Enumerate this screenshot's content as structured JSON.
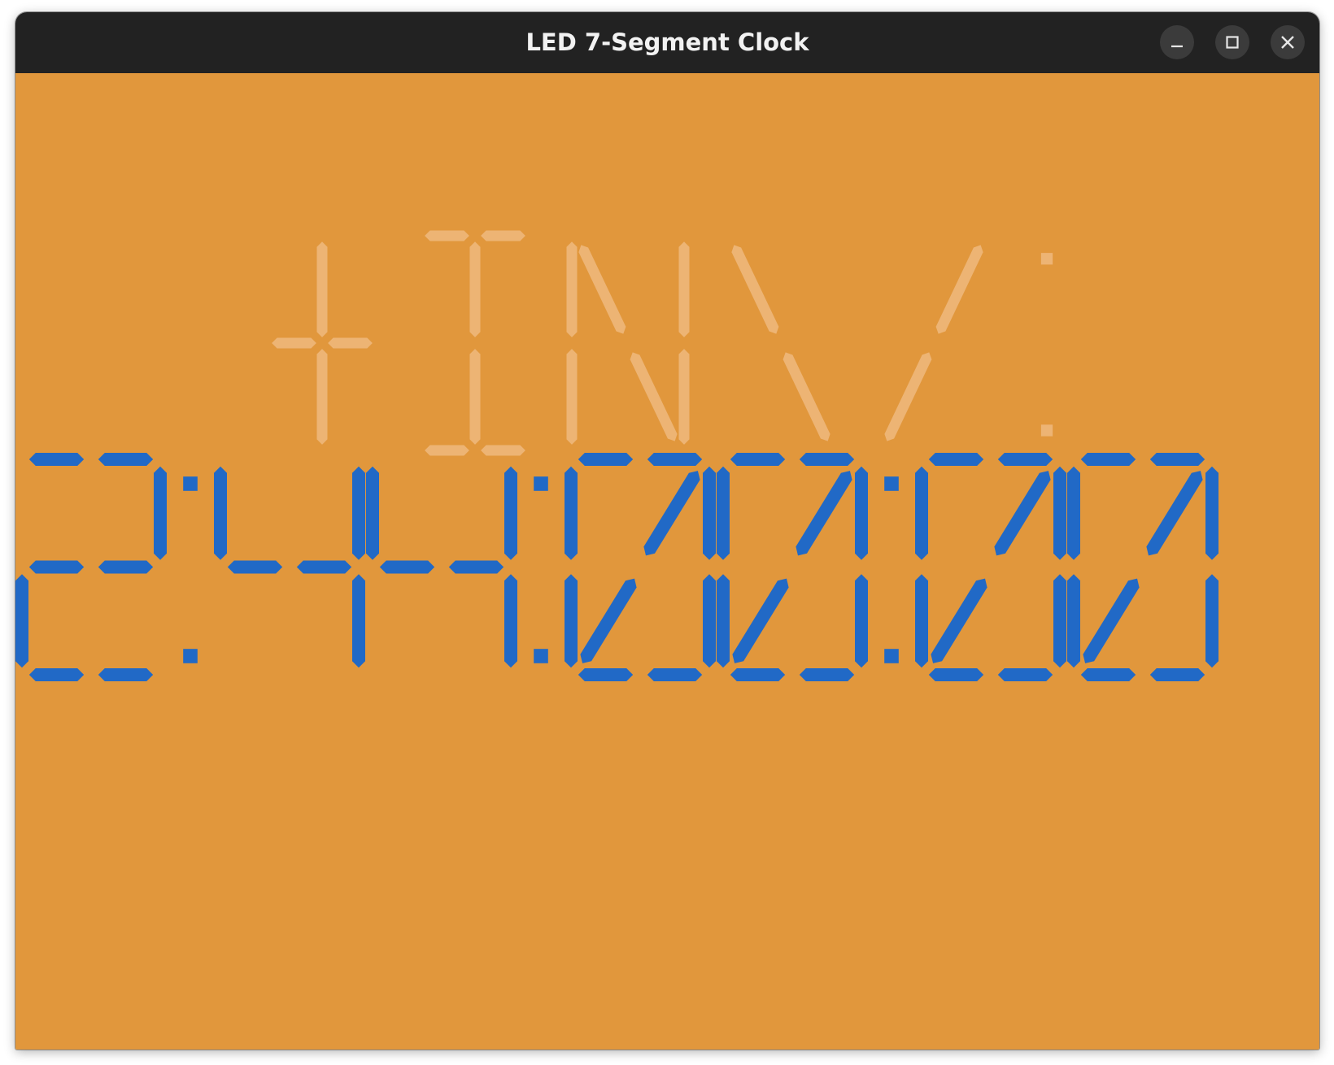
{
  "window": {
    "title": "LED 7-Segment Clock",
    "controls": [
      "minimize-icon",
      "maximize-icon",
      "close-icon"
    ]
  },
  "clock": {
    "time": "2:44:00:00",
    "ghost_glyphs": "+IN\\/:",
    "colors": {
      "background": "#E1973C",
      "segment_on": "#2169C6",
      "ghost_segment": "#EDB474",
      "titlebar": "#222222"
    }
  }
}
